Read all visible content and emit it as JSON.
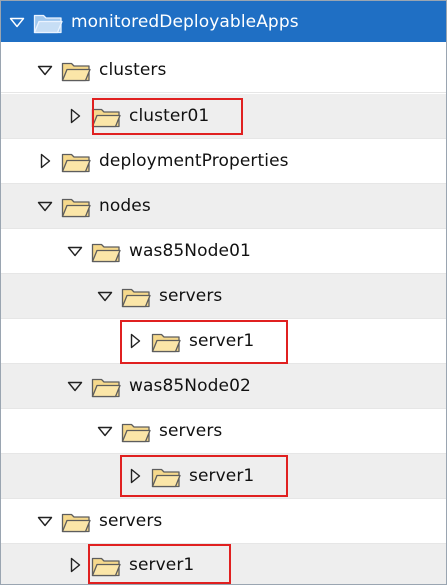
{
  "theme": {
    "selected_row_bg": "#1f6fc4",
    "alt_row_bg": "#eeeeee",
    "highlight_color": "#e02020",
    "folder_fill": "#f6d98c"
  },
  "tree": {
    "root": {
      "label": "monitoredDeployableApps",
      "expanded": true,
      "selected": true,
      "icon": "folder-icon",
      "toggle_icon": "expanded-arrow-icon"
    },
    "clusters": {
      "label": "clusters",
      "expanded": true,
      "icon": "folder-icon",
      "toggle_icon": "expanded-arrow-icon"
    },
    "cluster01": {
      "label": "cluster01",
      "expanded": false,
      "highlighted": true,
      "icon": "folder-icon",
      "toggle_icon": "collapsed-arrow-icon"
    },
    "deploymentProperties": {
      "label": "deploymentProperties",
      "expanded": false,
      "icon": "folder-icon",
      "toggle_icon": "collapsed-arrow-icon"
    },
    "nodes": {
      "label": "nodes",
      "expanded": true,
      "icon": "folder-icon",
      "toggle_icon": "expanded-arrow-icon"
    },
    "was85Node01": {
      "label": "was85Node01",
      "expanded": true,
      "icon": "folder-icon",
      "toggle_icon": "expanded-arrow-icon"
    },
    "node01_servers": {
      "label": "servers",
      "expanded": true,
      "icon": "folder-icon",
      "toggle_icon": "expanded-arrow-icon"
    },
    "node01_server1": {
      "label": "server1",
      "expanded": false,
      "highlighted": true,
      "icon": "folder-icon",
      "toggle_icon": "collapsed-arrow-icon"
    },
    "was85Node02": {
      "label": "was85Node02",
      "expanded": true,
      "icon": "folder-icon",
      "toggle_icon": "expanded-arrow-icon"
    },
    "node02_servers": {
      "label": "servers",
      "expanded": true,
      "icon": "folder-icon",
      "toggle_icon": "expanded-arrow-icon"
    },
    "node02_server1": {
      "label": "server1",
      "expanded": false,
      "highlighted": true,
      "icon": "folder-icon",
      "toggle_icon": "collapsed-arrow-icon"
    },
    "servers": {
      "label": "servers",
      "expanded": true,
      "icon": "folder-icon",
      "toggle_icon": "expanded-arrow-icon"
    },
    "servers_server1": {
      "label": "server1",
      "expanded": false,
      "highlighted": true,
      "icon": "folder-icon",
      "toggle_icon": "collapsed-arrow-icon"
    }
  }
}
